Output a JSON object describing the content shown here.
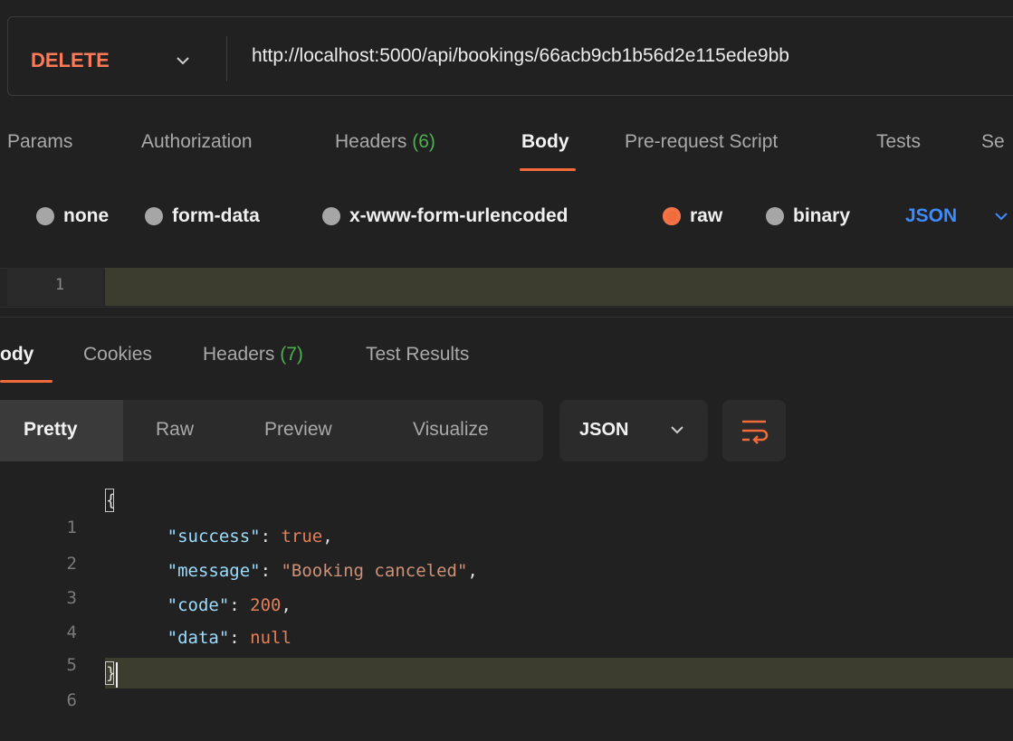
{
  "request": {
    "method": "DELETE",
    "method_color": "#ff7a59",
    "url": "http://localhost:5000/api/bookings/66acb9cb1b56d2e115ede9bb"
  },
  "request_tabs": [
    {
      "label": "Params"
    },
    {
      "label": "Authorization"
    },
    {
      "label": "Headers ",
      "count": "(6)"
    },
    {
      "label": "Body",
      "active": true
    },
    {
      "label": "Pre-request Script"
    },
    {
      "label": "Tests"
    },
    {
      "label": "Se"
    }
  ],
  "body_types": [
    {
      "label": "none"
    },
    {
      "label": "form-data"
    },
    {
      "label": "x-www-form-urlencoded"
    },
    {
      "label": "raw",
      "selected": true
    },
    {
      "label": "binary"
    }
  ],
  "body_format": "JSON",
  "request_editor": {
    "line_numbers": [
      "1"
    ]
  },
  "response_tabs": [
    {
      "label": "Body",
      "display": "ody",
      "active": true
    },
    {
      "label": "Cookies"
    },
    {
      "label": "Headers ",
      "count": "(7)"
    },
    {
      "label": "Test Results"
    }
  ],
  "response_views": [
    "Pretty",
    "Raw",
    "Preview",
    "Visualize"
  ],
  "response_format": "JSON",
  "response_lines": [
    {
      "n": "1",
      "text": "{"
    },
    {
      "n": "2",
      "key": "\"success\"",
      "value": "true",
      "vtype": "kw",
      "trail": ","
    },
    {
      "n": "3",
      "key": "\"message\"",
      "value": "\"Booking canceled\"",
      "vtype": "str",
      "trail": ","
    },
    {
      "n": "4",
      "key": "\"code\"",
      "value": "200",
      "vtype": "num",
      "trail": ","
    },
    {
      "n": "5",
      "key": "\"data\"",
      "value": "null",
      "vtype": "kw",
      "trail": ""
    },
    {
      "n": "6",
      "text": "}"
    }
  ],
  "colors": {
    "accent": "#f26b3a",
    "count_green": "#4caf50",
    "link_blue": "#3d8bff"
  }
}
